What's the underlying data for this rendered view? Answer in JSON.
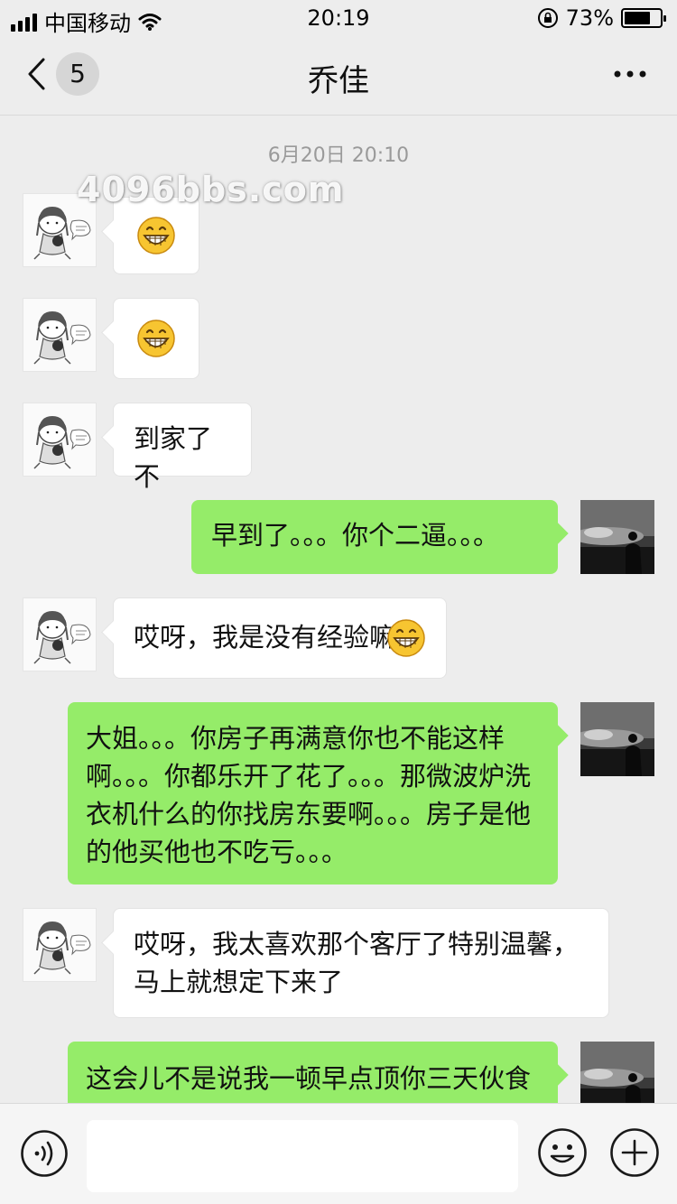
{
  "status_bar": {
    "carrier": "中国移动",
    "time": "20:19",
    "battery_percent_text": "73%",
    "battery_level": 0.73
  },
  "nav": {
    "unread_count": "5",
    "title": "乔佳"
  },
  "chat": {
    "timestamp": "6月20日 20:10",
    "watermark": "4096bbs.com",
    "messages": [
      {
        "side": "left",
        "type": "emoji",
        "icon": "grinning-face-icon"
      },
      {
        "side": "left",
        "type": "emoji",
        "icon": "grinning-face-icon"
      },
      {
        "side": "left",
        "type": "text",
        "text": "到家了不"
      },
      {
        "side": "right",
        "type": "text",
        "text": "早到了。。。你个二逼。。。"
      },
      {
        "side": "left",
        "type": "text",
        "text": "哎呀，我是没有经验嘛"
      },
      {
        "side": "right",
        "type": "text",
        "text": "大姐。。。你房子再满意你也不能这样啊。。。你都乐开了花了。。。那微波炉洗衣机什么的你找房东要啊。。。房子是他的他买他也不吃亏。。。"
      },
      {
        "side": "left",
        "type": "text",
        "text": "哎呀，我太喜欢那个客厅了特别温馨，马上就想定下来了"
      },
      {
        "side": "right",
        "type": "text",
        "text": "这会儿不是说我一顿早点顶你三天伙食"
      }
    ]
  },
  "colors": {
    "background": "#ededed",
    "bubble_self": "#95ec69",
    "bubble_other": "#ffffff",
    "emoji_yellow": "#f7c531"
  },
  "input_bar": {
    "placeholder": ""
  }
}
